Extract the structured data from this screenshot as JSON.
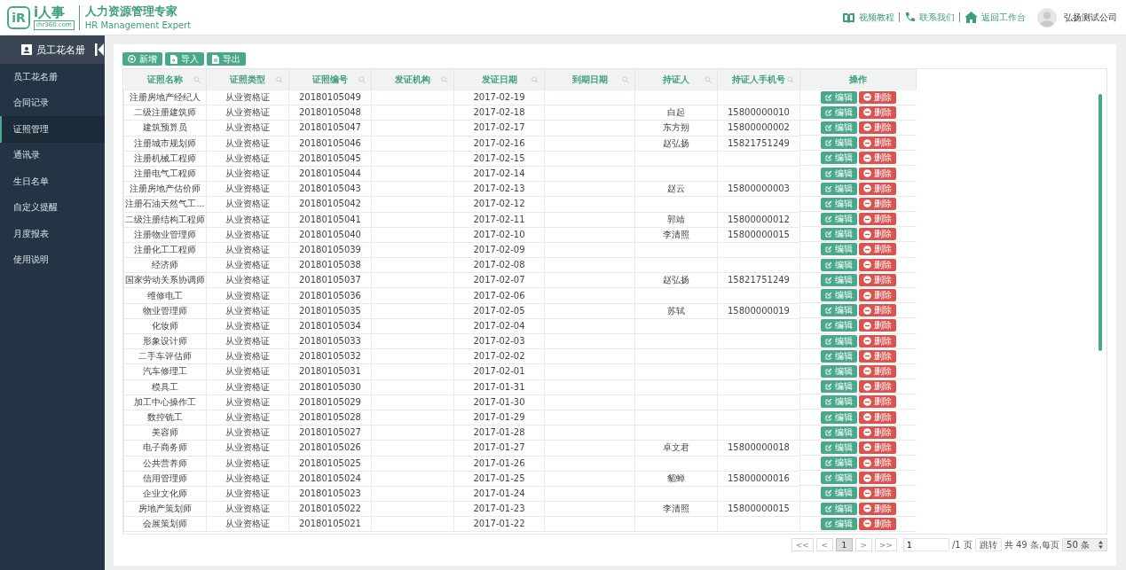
{
  "header": {
    "logo_mark": "iR",
    "brand": "i人事",
    "domain": "ihr360.com",
    "slogan": "人力资源管理专家",
    "slogan_en": "HR Management Expert",
    "links": [
      {
        "kind": "book",
        "label": "视频教程"
      },
      {
        "kind": "phone",
        "label": "联系我们"
      },
      {
        "kind": "home",
        "label": "返回工作台"
      }
    ],
    "company": "弘扬测试公司"
  },
  "sidebar": {
    "title": "员工花名册",
    "items": [
      {
        "label": "员工花名册",
        "selected": false
      },
      {
        "label": "合同记录",
        "selected": false
      },
      {
        "label": "证照管理",
        "selected": true
      },
      {
        "label": "通讯录",
        "selected": false
      },
      {
        "label": "生日名单",
        "selected": false
      },
      {
        "label": "自定义提醒",
        "selected": false
      },
      {
        "label": "月度报表",
        "selected": false
      },
      {
        "label": "使用说明",
        "selected": false
      }
    ]
  },
  "toolbar": [
    {
      "kind": "add",
      "label": "新增"
    },
    {
      "kind": "import",
      "label": "导入"
    },
    {
      "kind": "export",
      "label": "导出"
    }
  ],
  "table": {
    "columns": [
      {
        "label": "证照名称",
        "searchable": true
      },
      {
        "label": "证照类型",
        "searchable": true
      },
      {
        "label": "证照编号",
        "searchable": true
      },
      {
        "label": "发证机构",
        "searchable": true
      },
      {
        "label": "发证日期",
        "searchable": true
      },
      {
        "label": "到期日期",
        "searchable": true
      },
      {
        "label": "持证人",
        "searchable": true
      },
      {
        "label": "持证人手机号",
        "searchable": true
      },
      {
        "label": "操作",
        "searchable": false
      }
    ],
    "rows": [
      [
        "注册房地产经纪人",
        "从业资格证",
        "20180105049",
        "",
        "2017-02-19",
        "",
        "",
        "",
        [
          "编辑",
          "删除"
        ]
      ],
      [
        "二级注册建筑师",
        "从业资格证",
        "20180105048",
        "",
        "2017-02-18",
        "",
        "白起",
        "15800000010",
        [
          "编辑",
          "删除"
        ]
      ],
      [
        "建筑预算员",
        "从业资格证",
        "20180105047",
        "",
        "2017-02-17",
        "",
        "东方朔",
        "15800000002",
        [
          "编辑",
          "删除"
        ]
      ],
      [
        "注册城市规划师",
        "从业资格证",
        "20180105046",
        "",
        "2017-02-16",
        "",
        "赵弘扬",
        "15821751249",
        [
          "编辑",
          "删除"
        ]
      ],
      [
        "注册机械工程师",
        "从业资格证",
        "20180105045",
        "",
        "2017-02-15",
        "",
        "",
        "",
        [
          "编辑",
          "删除"
        ]
      ],
      [
        "注册电气工程师",
        "从业资格证",
        "20180105044",
        "",
        "2017-02-14",
        "",
        "",
        "",
        [
          "编辑",
          "删除"
        ]
      ],
      [
        "注册房地产估价师",
        "从业资格证",
        "20180105043",
        "",
        "2017-02-13",
        "",
        "赵云",
        "15800000003",
        [
          "编辑",
          "删除"
        ]
      ],
      [
        "注册石油天然气工...",
        "从业资格证",
        "20180105042",
        "",
        "2017-02-12",
        "",
        "",
        "",
        [
          "编辑",
          "删除"
        ]
      ],
      [
        "二级注册结构工程师",
        "从业资格证",
        "20180105041",
        "",
        "2017-02-11",
        "",
        "郭靖",
        "15800000012",
        [
          "编辑",
          "删除"
        ]
      ],
      [
        "注册物业管理师",
        "从业资格证",
        "20180105040",
        "",
        "2017-02-10",
        "",
        "李清照",
        "15800000015",
        [
          "编辑",
          "删除"
        ]
      ],
      [
        "注册化工工程师",
        "从业资格证",
        "20180105039",
        "",
        "2017-02-09",
        "",
        "",
        "",
        [
          "编辑",
          "删除"
        ]
      ],
      [
        "经济师",
        "从业资格证",
        "20180105038",
        "",
        "2017-02-08",
        "",
        "",
        "",
        [
          "编辑",
          "删除"
        ]
      ],
      [
        "国家劳动关系协调师",
        "从业资格证",
        "20180105037",
        "",
        "2017-02-07",
        "",
        "赵弘扬",
        "15821751249",
        [
          "编辑",
          "删除"
        ]
      ],
      [
        "维修电工",
        "从业资格证",
        "20180105036",
        "",
        "2017-02-06",
        "",
        "",
        "",
        [
          "编辑",
          "删除"
        ]
      ],
      [
        "物业管理师",
        "从业资格证",
        "20180105035",
        "",
        "2017-02-05",
        "",
        "苏轼",
        "15800000019",
        [
          "编辑",
          "删除"
        ]
      ],
      [
        "化妆师",
        "从业资格证",
        "20180105034",
        "",
        "2017-02-04",
        "",
        "",
        "",
        [
          "编辑",
          "删除"
        ]
      ],
      [
        "形象设计师",
        "从业资格证",
        "20180105033",
        "",
        "2017-02-03",
        "",
        "",
        "",
        [
          "编辑",
          "删除"
        ]
      ],
      [
        "二手车评估师",
        "从业资格证",
        "20180105032",
        "",
        "2017-02-02",
        "",
        "",
        "",
        [
          "编辑",
          "删除"
        ]
      ],
      [
        "汽车修理工",
        "从业资格证",
        "20180105031",
        "",
        "2017-02-01",
        "",
        "",
        "",
        [
          "编辑",
          "删除"
        ]
      ],
      [
        "模具工",
        "从业资格证",
        "20180105030",
        "",
        "2017-01-31",
        "",
        "",
        "",
        [
          "编辑",
          "删除"
        ]
      ],
      [
        "加工中心操作工",
        "从业资格证",
        "20180105029",
        "",
        "2017-01-30",
        "",
        "",
        "",
        [
          "编辑",
          "删除"
        ]
      ],
      [
        "数控铣工",
        "从业资格证",
        "20180105028",
        "",
        "2017-01-29",
        "",
        "",
        "",
        [
          "编辑",
          "删除"
        ]
      ],
      [
        "美容师",
        "从业资格证",
        "20180105027",
        "",
        "2017-01-28",
        "",
        "",
        "",
        [
          "编辑",
          "删除"
        ]
      ],
      [
        "电子商务师",
        "从业资格证",
        "20180105026",
        "",
        "2017-01-27",
        "",
        "卓文君",
        "15800000018",
        [
          "编辑",
          "删除"
        ]
      ],
      [
        "公共营养师",
        "从业资格证",
        "20180105025",
        "",
        "2017-01-26",
        "",
        "",
        "",
        [
          "编辑",
          "删除"
        ]
      ],
      [
        "信用管理师",
        "从业资格证",
        "20180105024",
        "",
        "2017-01-25",
        "",
        "貂蝉",
        "15800000016",
        [
          "编辑",
          "删除"
        ]
      ],
      [
        "企业文化师",
        "从业资格证",
        "20180105023",
        "",
        "2017-01-24",
        "",
        "",
        "",
        [
          "编辑",
          "删除"
        ]
      ],
      [
        "房地产策划师",
        "从业资格证",
        "20180105022",
        "",
        "2017-01-23",
        "",
        "李清照",
        "15800000015",
        [
          "编辑",
          "删除"
        ]
      ],
      [
        "会展策划师",
        "从业资格证",
        "20180105021",
        "",
        "2017-01-22",
        "",
        "",
        "",
        [
          "编辑",
          "删除"
        ]
      ]
    ]
  },
  "pagination": {
    "pages": [
      {
        "label": "<<",
        "selected": false
      },
      {
        "label": "<",
        "selected": false
      },
      {
        "label": "1",
        "selected": true
      },
      {
        "label": ">",
        "selected": false
      },
      {
        "label": ">>",
        "selected": false
      }
    ],
    "page_input": "1",
    "total_pages": "/1 页",
    "go": "跳转",
    "summary": "共 49 条,每页",
    "page_size": "50 条"
  }
}
